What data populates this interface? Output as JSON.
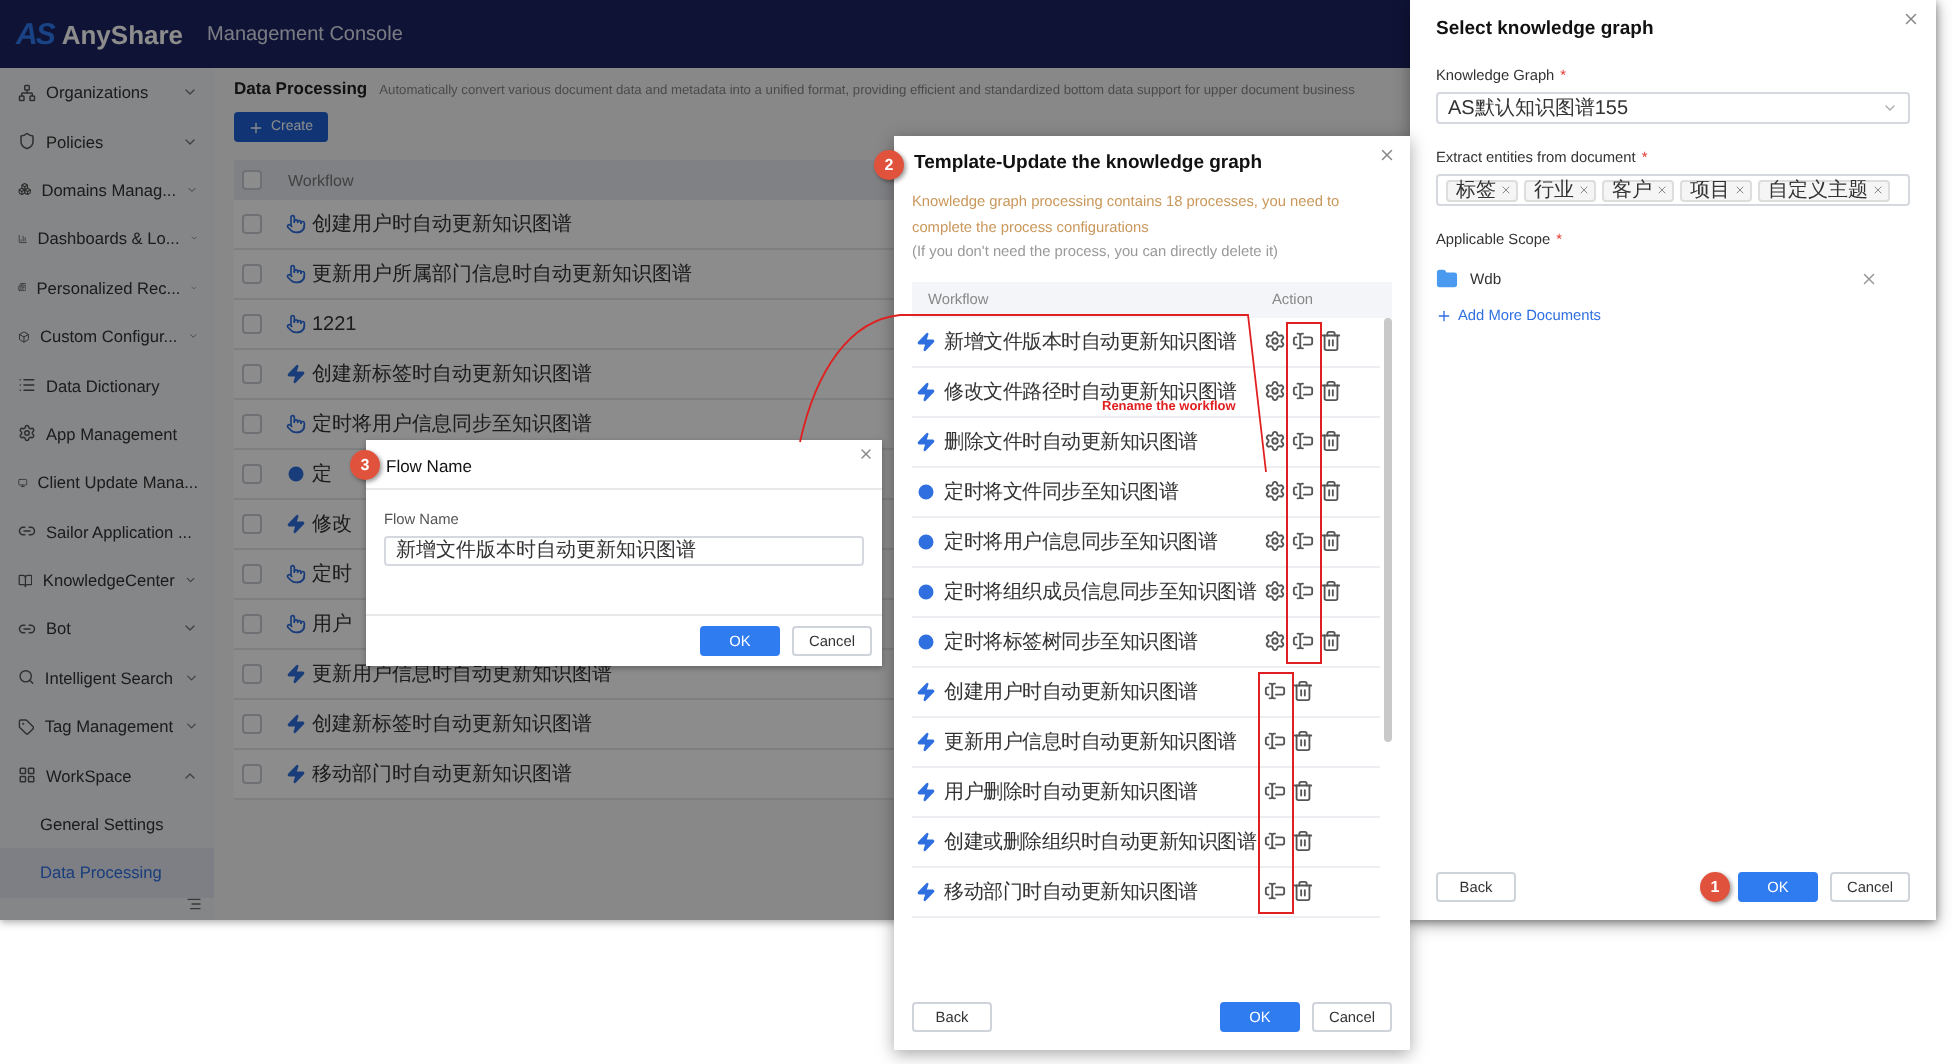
{
  "app_header": {
    "brand_mark": "AS",
    "brand": "AnyShare",
    "subtitle": "Management Console"
  },
  "sidebar": {
    "items": [
      {
        "label": "Organizations",
        "expandable": true,
        "expanded": false,
        "selected": false
      },
      {
        "label": "Policies",
        "expandable": true,
        "expanded": false,
        "selected": false
      },
      {
        "label": "Domains Manag...",
        "expandable": true,
        "expanded": false,
        "selected": false
      },
      {
        "label": "Dashboards & Lo...",
        "expandable": true,
        "expanded": false,
        "selected": false
      },
      {
        "label": "Personalized Rec...",
        "expandable": true,
        "expanded": false,
        "selected": false
      },
      {
        "label": "Custom Configur...",
        "expandable": true,
        "expanded": false,
        "selected": false
      },
      {
        "label": "Data Dictionary",
        "expandable": false,
        "selected": false
      },
      {
        "label": "App Management",
        "expandable": false,
        "selected": false
      },
      {
        "label": "Client Update Mana...",
        "expandable": false,
        "selected": false
      },
      {
        "label": "Sailor Application ...",
        "expandable": false,
        "selected": false
      },
      {
        "label": "KnowledgeCenter",
        "expandable": true,
        "expanded": false,
        "selected": false
      },
      {
        "label": "Bot",
        "expandable": true,
        "expanded": false,
        "selected": false
      },
      {
        "label": "Intelligent Search",
        "expandable": true,
        "expanded": false,
        "selected": false
      },
      {
        "label": "Tag Management",
        "expandable": true,
        "expanded": false,
        "selected": false
      },
      {
        "label": "WorkSpace",
        "expandable": true,
        "expanded": true,
        "selected": false,
        "children": [
          {
            "label": "General Settings",
            "selected": false
          },
          {
            "label": "Data Processing",
            "selected": true
          }
        ]
      }
    ]
  },
  "page": {
    "title": "Data Processing",
    "description": "Automatically convert various document data and metadata into a unified format, providing efficient and standardized bottom data support for upper document business",
    "create_button": "Create",
    "table": {
      "column": "Workflow",
      "all_checked": false,
      "rows": [
        {
          "kind": "manual",
          "name": "创建用户时自动更新知识图谱",
          "checked": false
        },
        {
          "kind": "manual",
          "name": "更新用户所属部门信息时自动更新知识图谱",
          "checked": false
        },
        {
          "kind": "manual",
          "name": "1221",
          "checked": false
        },
        {
          "kind": "event",
          "name": "创建新标签时自动更新知识图谱",
          "checked": false
        },
        {
          "kind": "manual",
          "name": "定时将用户信息同步至知识图谱",
          "checked": false
        },
        {
          "kind": "schedule",
          "name": "定",
          "checked": false
        },
        {
          "kind": "event",
          "name": "修改",
          "checked": false
        },
        {
          "kind": "manual",
          "name": "定时",
          "checked": false
        },
        {
          "kind": "manual",
          "name": "用户",
          "checked": false
        },
        {
          "kind": "event",
          "name": "更新用户信息时自动更新知识图谱",
          "checked": false
        },
        {
          "kind": "event",
          "name": "创建新标签时自动更新知识图谱",
          "checked": false
        },
        {
          "kind": "event",
          "name": "移动部门时自动更新知识图谱",
          "checked": false
        }
      ]
    }
  },
  "template_dialog": {
    "step_badge": "2",
    "title": "Template-Update the knowledge graph",
    "description": "Knowledge graph processing contains 18 processes, you need to complete the process configurations",
    "note": "(If you don't need the process, you can directly delete it)",
    "columns": [
      "Workflow",
      "Action"
    ],
    "rows": [
      {
        "kind": "event",
        "name": "新增文件版本时自动更新知识图谱",
        "configurable": true
      },
      {
        "kind": "event",
        "name": "修改文件路径时自动更新知识图谱",
        "configurable": true
      },
      {
        "kind": "event",
        "name": "删除文件时自动更新知识图谱",
        "configurable": true
      },
      {
        "kind": "schedule",
        "name": "定时将文件同步至知识图谱",
        "configurable": true
      },
      {
        "kind": "schedule",
        "name": "定时将用户信息同步至知识图谱",
        "configurable": true
      },
      {
        "kind": "schedule",
        "name": "定时将组织成员信息同步至知识图谱",
        "configurable": true
      },
      {
        "kind": "schedule",
        "name": "定时将标签树同步至知识图谱",
        "configurable": true
      },
      {
        "kind": "event",
        "name": "创建用户时自动更新知识图谱",
        "configurable": false
      },
      {
        "kind": "event",
        "name": "更新用户信息时自动更新知识图谱",
        "configurable": false
      },
      {
        "kind": "event",
        "name": "用户删除时自动更新知识图谱",
        "configurable": false
      },
      {
        "kind": "event",
        "name": "创建或删除组织时自动更新知识图谱",
        "configurable": false
      },
      {
        "kind": "event",
        "name": "移动部门时自动更新知识图谱",
        "configurable": false
      }
    ],
    "buttons": {
      "back": "Back",
      "ok": "OK",
      "cancel": "Cancel"
    }
  },
  "annotation_label": "Rename the workflow",
  "flow_name_dialog": {
    "step_badge": "3",
    "title": "Flow Name",
    "field_label": "Flow Name",
    "value": "新增文件版本时自动更新知识图谱",
    "buttons": {
      "ok": "OK",
      "cancel": "Cancel"
    }
  },
  "knowledge_graph_drawer": {
    "title": "Select knowledge graph",
    "graph": {
      "label": "Knowledge Graph",
      "required_mark": "*",
      "value": "AS默认知识图谱155"
    },
    "entities": {
      "label": "Extract entities from document",
      "required_mark": "*",
      "tags": [
        "标签",
        "行业",
        "客户",
        "项目",
        "自定义主题"
      ]
    },
    "scope": {
      "label": "Applicable Scope",
      "required_mark": "*",
      "documents": [
        "Wdb"
      ],
      "add_link": "Add More Documents"
    },
    "buttons": {
      "back": "Back",
      "ok": "OK",
      "cancel": "Cancel"
    },
    "ok_badge": "1"
  }
}
